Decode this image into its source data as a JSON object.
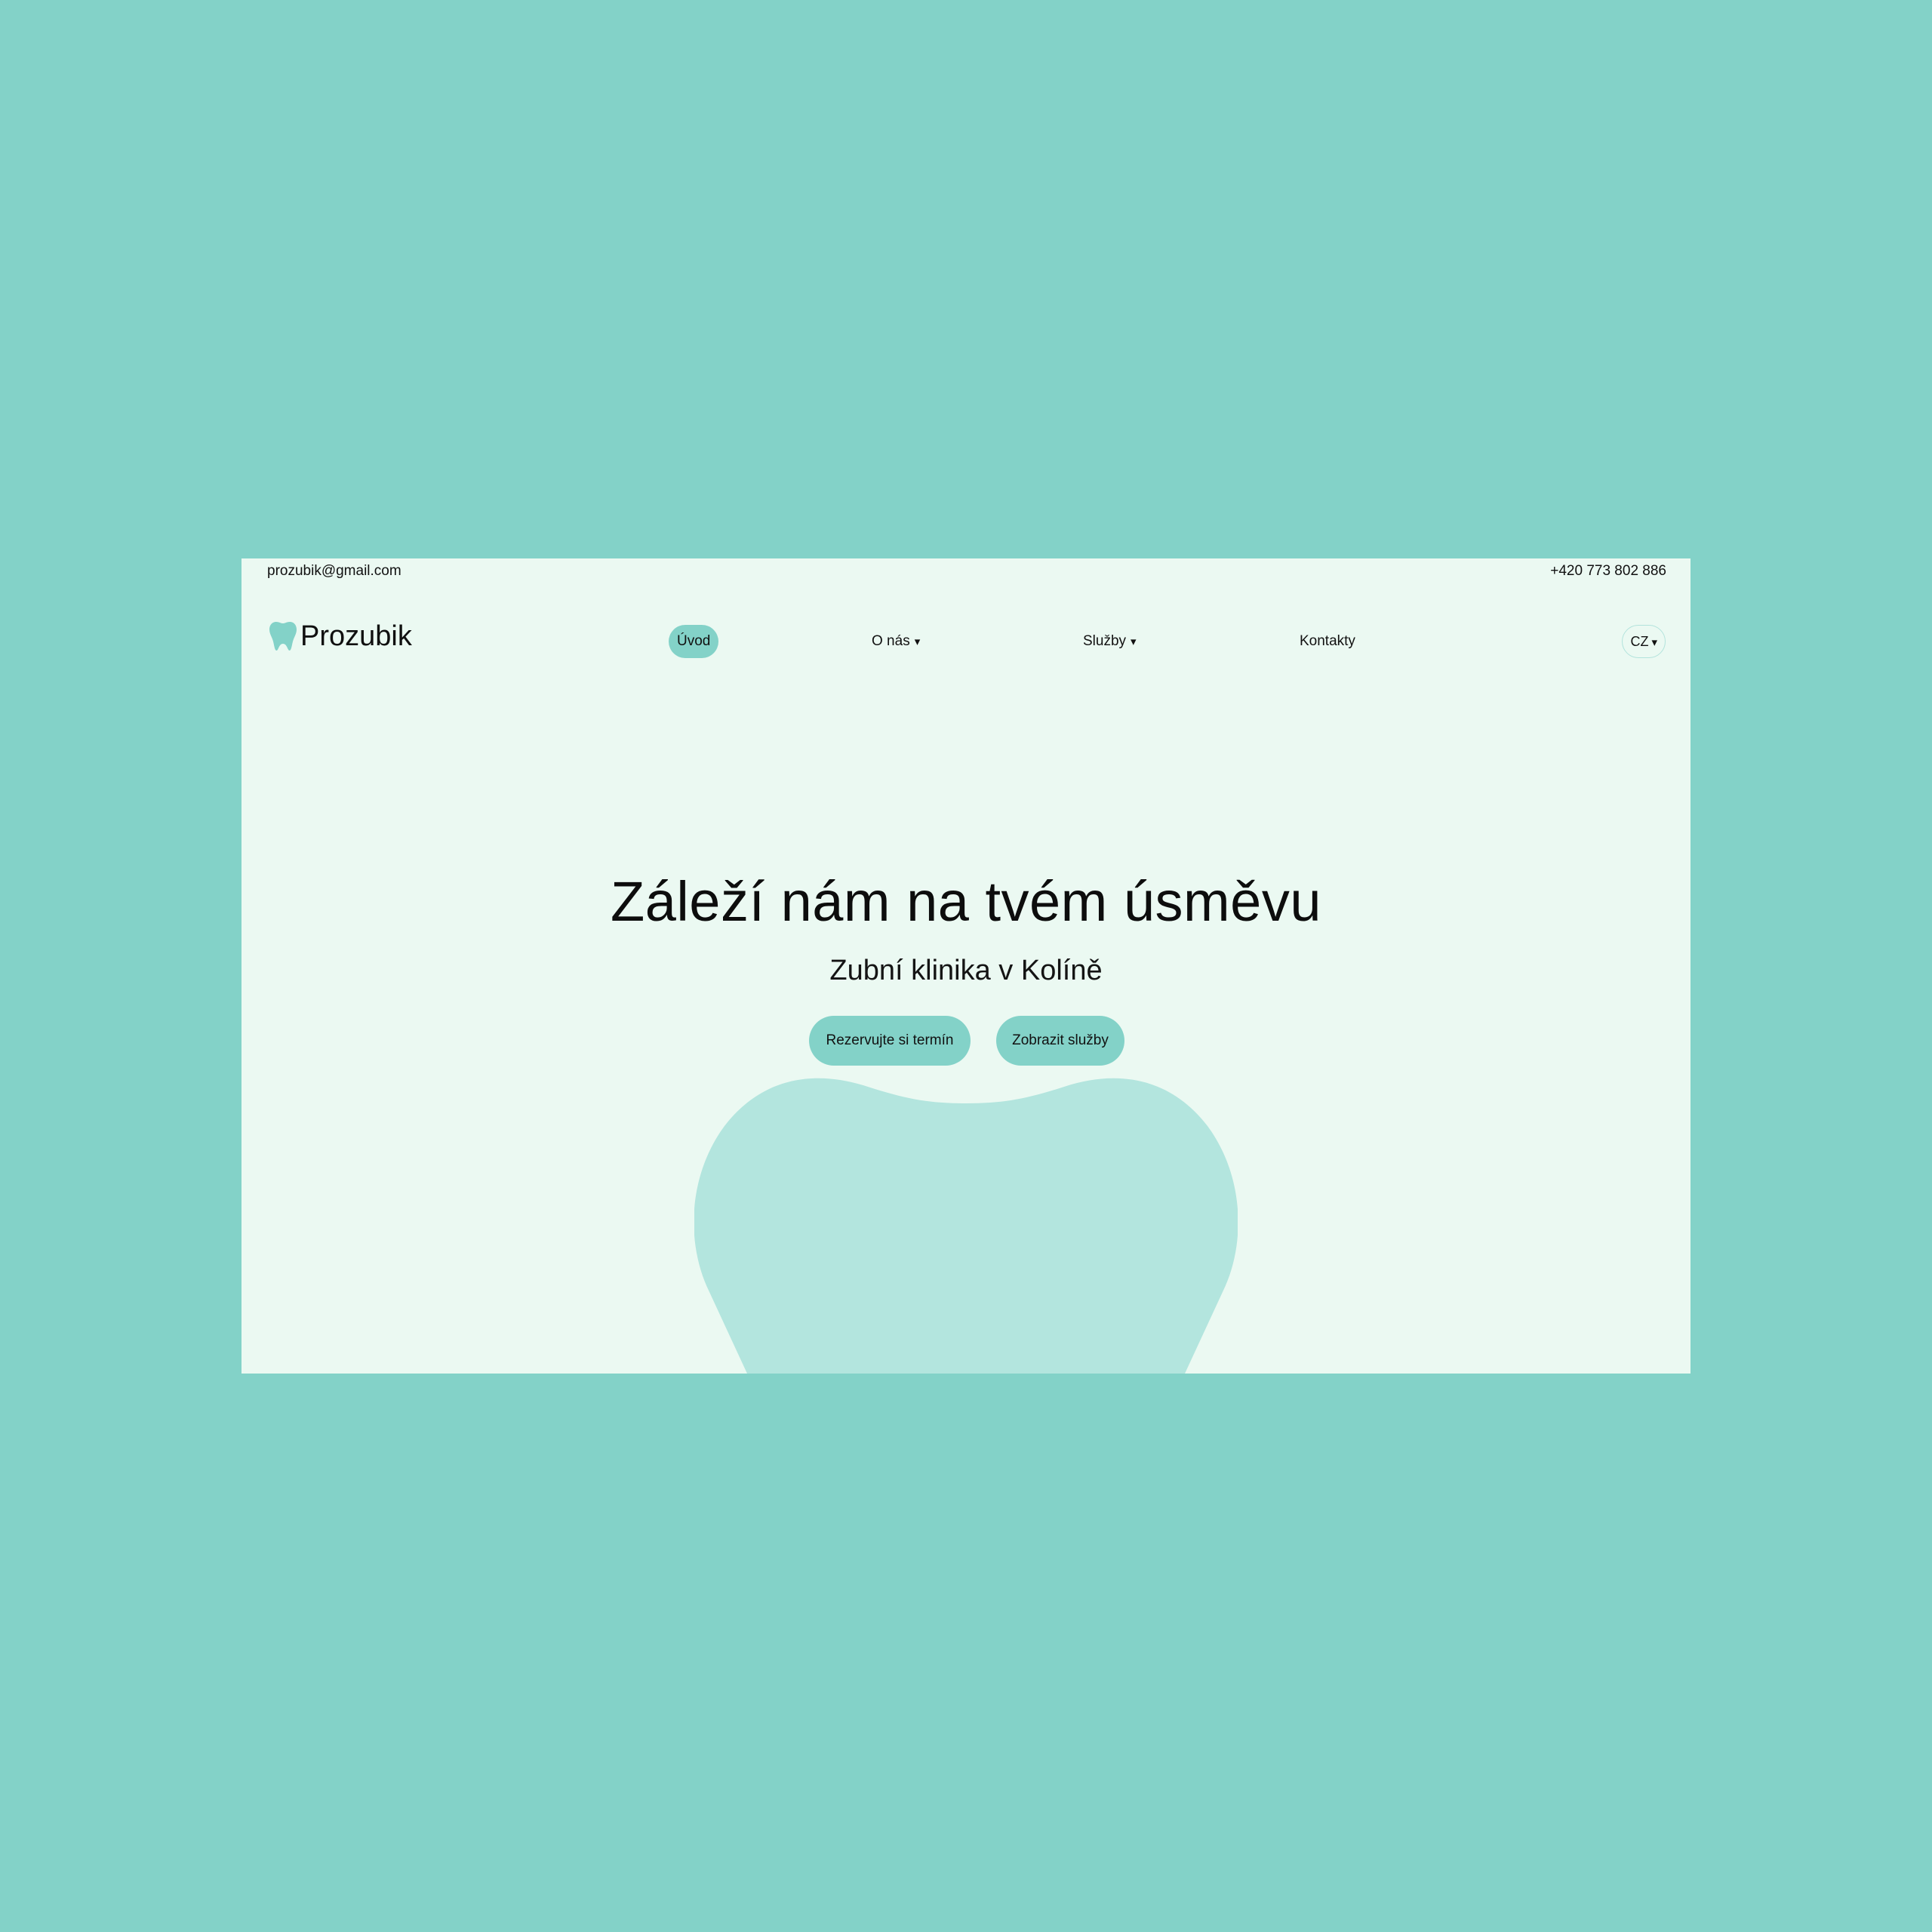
{
  "colors": {
    "backdrop": "#83d2c8",
    "page": "#ebf9f2",
    "accent": "#83d2c8",
    "tooth_shape": "#b3e5de"
  },
  "topbar": {
    "email": "prozubik@gmail.com",
    "phone": "+420 773 802 886"
  },
  "brand": {
    "icon": "tooth-icon",
    "name": "Prozubik"
  },
  "nav": {
    "items": [
      {
        "label": "Úvod",
        "active": true,
        "dropdown": false
      },
      {
        "label": "O nás",
        "active": false,
        "dropdown": true
      },
      {
        "label": "Služby",
        "active": false,
        "dropdown": true
      },
      {
        "label": "Kontakty",
        "active": false,
        "dropdown": false
      }
    ],
    "caret": "▾",
    "language": "CZ"
  },
  "hero": {
    "title": "Záleží nám na tvém úsměvu",
    "subtitle": "Zubní klinika v Kolíně",
    "buttons": {
      "book": "Rezervujte si termín",
      "services": "Zobrazit služby"
    }
  }
}
